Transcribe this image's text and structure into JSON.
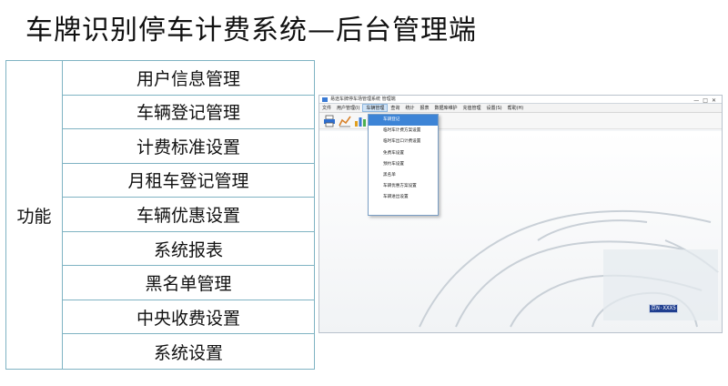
{
  "page": {
    "title": "车牌识别停车计费系统—后台管理端"
  },
  "feature_table": {
    "category": "功能",
    "items": [
      "用户信息管理",
      "车辆登记管理",
      "计费标准设置",
      "月租车登记管理",
      "车辆优惠设置",
      "系统报表",
      "黑名单管理",
      "中央收费设置",
      "系统设置"
    ]
  },
  "app": {
    "window_title": "易途车牌停车场管理系统 管理端",
    "menu": [
      "文件",
      "用户管理(I)",
      "车辆管理",
      "查询",
      "统计",
      "报表",
      "数据库维护",
      "充值管理",
      "设置(S)",
      "帮助(H)"
    ],
    "active_menu_index": 2,
    "toolbar_icons": [
      "printer-icon",
      "chart-icon",
      "bar-chart-icon"
    ],
    "dropdown_items": [
      "车辆登记",
      "临时车计费方案设置",
      "临时车出口计费设置",
      "免费车设置",
      "预约车设置",
      "黑名单",
      "车辆优惠方案设置",
      "车辆进出设置"
    ],
    "dropdown_selected_index": 0,
    "plate_text": "京N·XXX5"
  }
}
